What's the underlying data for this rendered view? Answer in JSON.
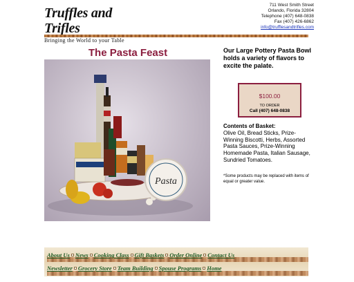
{
  "header": {
    "logo_title": "Truffles and Trifles",
    "logo_tagline": "Bringing the World to your Table",
    "address": {
      "street": "711 West Smith Street",
      "city": "Orlando, Florida 32804",
      "telephone": "Telephone (407) 648-0838",
      "fax": "Fax (407) 426-6862",
      "email": "info@trufflesandtrifles.com"
    }
  },
  "product": {
    "title": "The Pasta Feast",
    "headline": "Our Large Pottery Pasta Bowl holds a variety of flavors to excite the palate.",
    "price": "$100.00",
    "order_label": "TO ORDER",
    "order_phone": "Call (407) 648-0838",
    "contents_title": "Contents of Basket:",
    "contents_text": "Olive Oil, Bread Sticks, Prize-Winning Biscotti, Herbs, Assorted Pasta Sauces, Prize-Winning Homemade Pasta, Italian Sausage, Sundried Tomatoes.",
    "note": "*Some products may be replaced with items of equal or greater value.",
    "plate_label": "Pasta"
  },
  "nav": {
    "row1": [
      "About Us",
      "News",
      "Cooking Class",
      "Gift Baskets",
      "Order Online",
      "Contact Us"
    ],
    "row2": [
      "Newsletter",
      "Grocery Store",
      "Team Building",
      "Spouse Programs",
      "Home"
    ]
  },
  "colors": {
    "title_maroon": "#8b1e3f",
    "nav_green": "#1d5a23",
    "price_box_bg": "#ead7c6",
    "link_blue": "#1a33b8"
  }
}
